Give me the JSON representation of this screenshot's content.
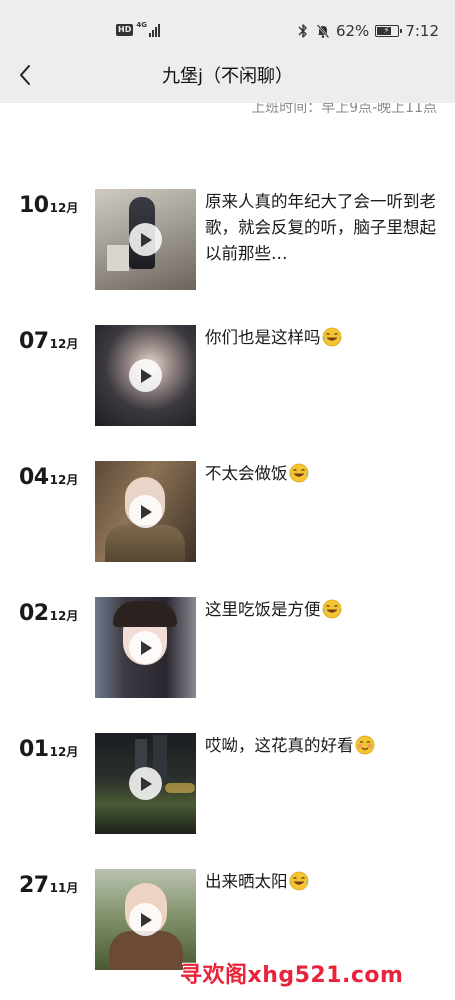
{
  "status_bar": {
    "hd": "HD",
    "network": "4G",
    "battery_text": "62%",
    "battery_level": 0.62,
    "time": "7:12"
  },
  "nav": {
    "title": "九堡j（不闲聊）"
  },
  "hours_text": "上班时间：早上9点-晚上11点",
  "posts": [
    {
      "day": "10",
      "month": "12月",
      "text": "原来人真的年纪大了会一听到老歌，就会反复的听，脑子里想起以前那些…",
      "emoji": "",
      "thumb_color": "#a7a49e"
    },
    {
      "day": "07",
      "month": "12月",
      "text": "你们也是这样吗",
      "emoji": "laughing-tears",
      "thumb_color": "#3b3b40"
    },
    {
      "day": "04",
      "month": "12月",
      "text": "不太会做饭",
      "emoji": "laughing-tears",
      "thumb_color": "#6e5a44"
    },
    {
      "day": "02",
      "month": "12月",
      "text": "这里吃饭是方便",
      "emoji": "laughing-tears",
      "thumb_color": "#4a4d55"
    },
    {
      "day": "01",
      "month": "12月",
      "text": "哎呦，这花真的好看",
      "emoji": "shy-smile",
      "thumb_color": "#1e2421"
    },
    {
      "day": "27",
      "month": "11月",
      "text": "出来晒太阳",
      "emoji": "laughing-tears",
      "thumb_color": "#7c8b6a"
    }
  ],
  "watermark": "寻欢阁xhg521.com"
}
